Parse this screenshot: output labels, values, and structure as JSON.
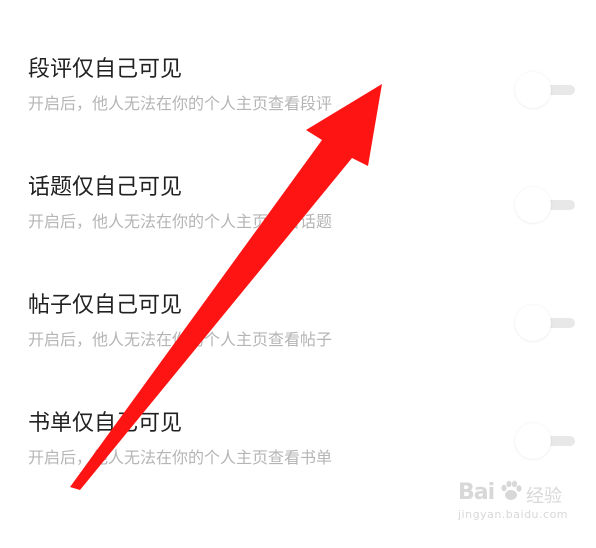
{
  "settings": [
    {
      "title": "段评仅自己可见",
      "description": "开启后，他人无法在你的个人主页查看段评",
      "enabled": false
    },
    {
      "title": "话题仅自己可见",
      "description": "开启后，他人无法在你的个人主页查看话题",
      "enabled": false
    },
    {
      "title": "帖子仅自己可见",
      "description": "开启后，他人无法在你的个人主页查看帖子",
      "enabled": false
    },
    {
      "title": "书单仅自己可见",
      "description": "开启后，他人无法在你的个人主页查看书单",
      "enabled": false
    }
  ],
  "colors": {
    "title_text": "#222222",
    "description_text": "#b5b5b5",
    "toggle_track_off": "#e8e8e8",
    "annotation_arrow": "#ff1414",
    "watermark": "#d8d8d8"
  },
  "watermark": {
    "logo_text": "Bai",
    "logo_suffix": "经验",
    "url": "jingyan.baidu.com"
  },
  "annotation": {
    "icon": "red-arrow-icon"
  }
}
